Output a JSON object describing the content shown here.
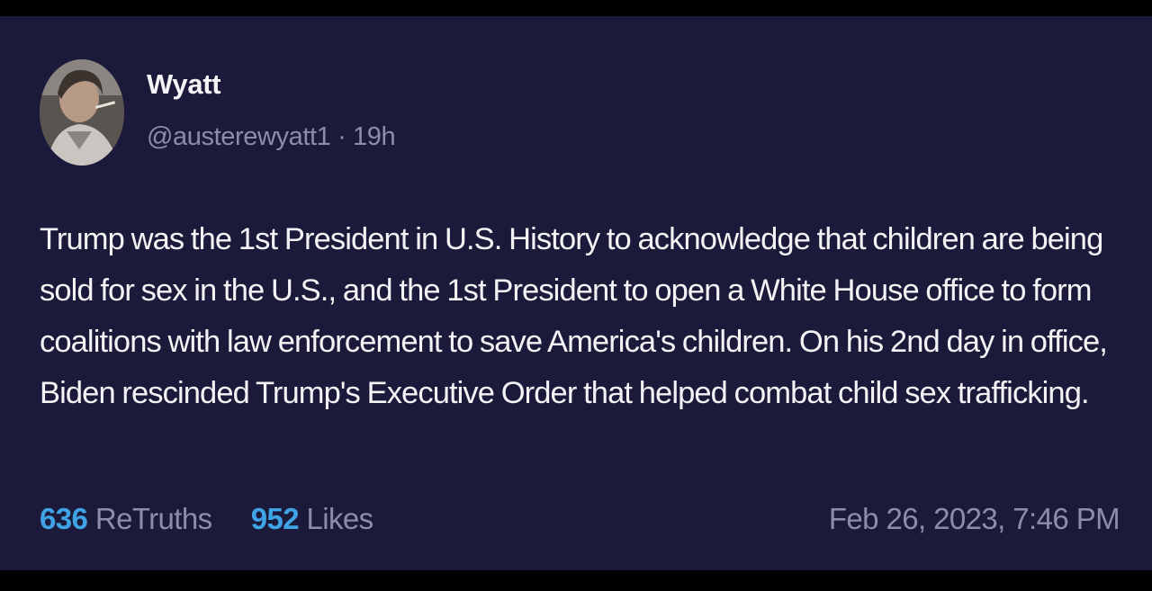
{
  "post": {
    "author": {
      "display_name": "Wyatt",
      "handle": "@austerewyatt1",
      "separator": "·",
      "relative_time": "19h",
      "avatar_icon": "avatar-photo"
    },
    "body": "Trump was the 1st President in U.S. History to acknowledge that children are being sold for sex in the U.S., and the 1st President to open a White House office to form coalitions with law enforcement to save America's children. On his 2nd day in office, Biden rescinded Trump's Executive Order that helped combat child sex trafficking.",
    "stats": {
      "retruths_count": "636",
      "retruths_label": "ReTruths",
      "likes_count": "952",
      "likes_label": "Likes"
    },
    "timestamp": "Feb 26, 2023, 7:46 PM"
  },
  "colors": {
    "background": "#1c1a3a",
    "text": "#f3f3f5",
    "muted": "#8e8ca6",
    "accent": "#3fa4e6"
  }
}
